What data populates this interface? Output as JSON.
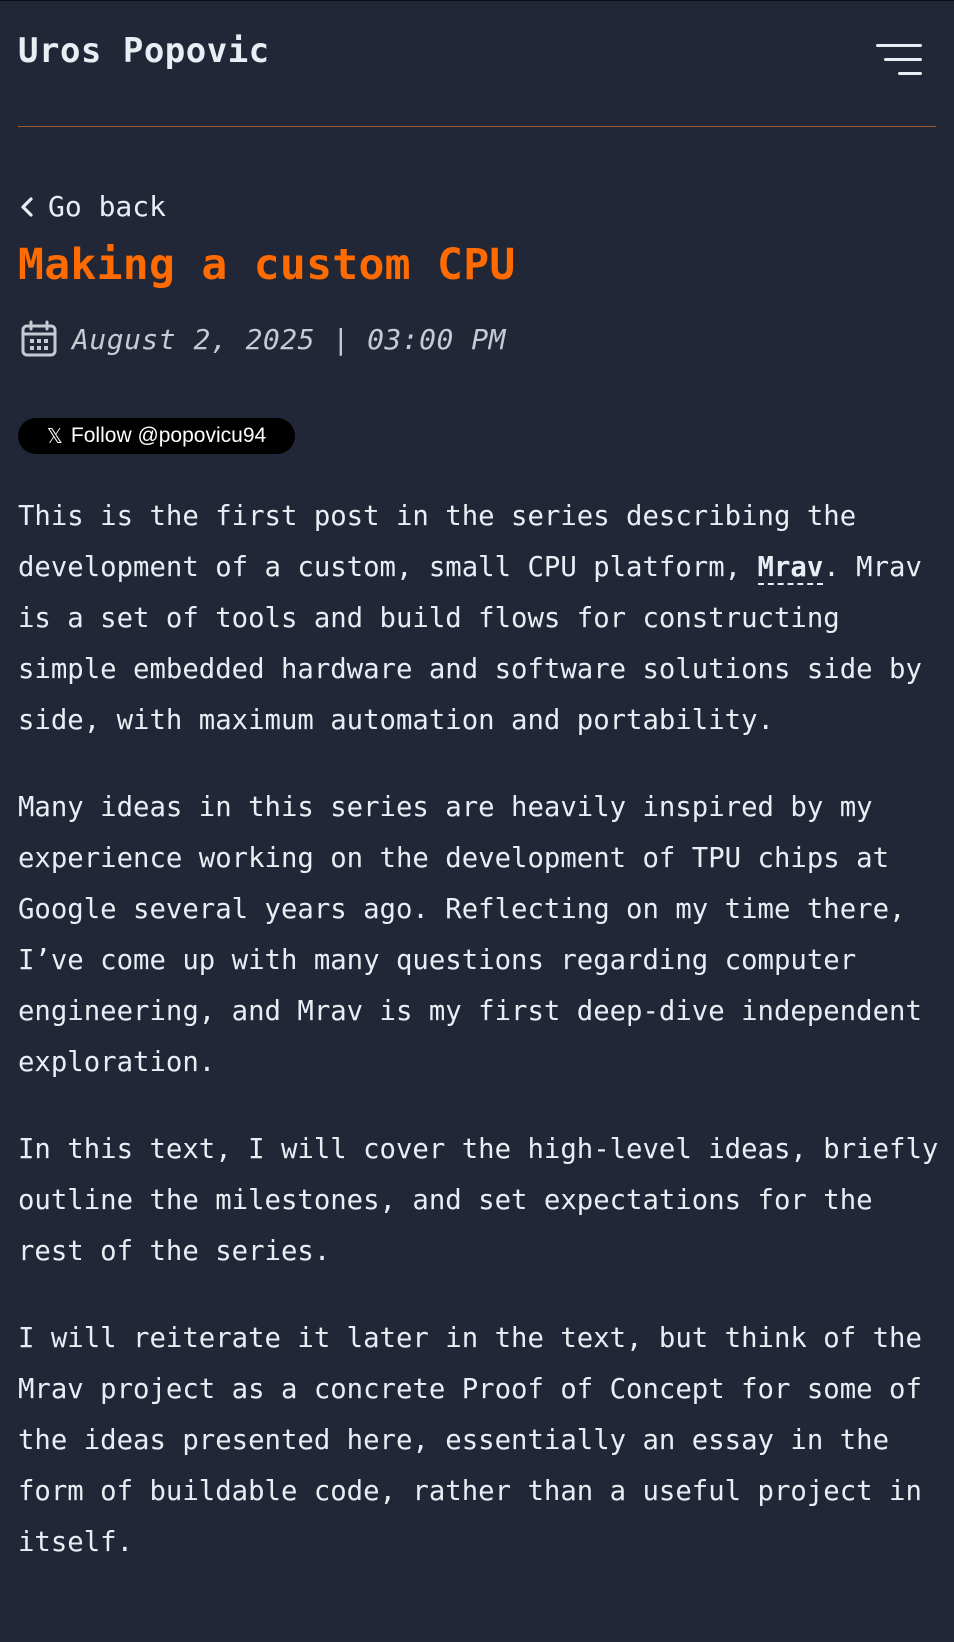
{
  "header": {
    "site_title": "Uros Popovic",
    "menu_icon": "hamburger-menu-icon"
  },
  "nav": {
    "back_label": "Go back",
    "back_icon": "chevron-left-icon"
  },
  "post": {
    "title": "Making a custom CPU",
    "date": "August 2, 2025 | 03:00 PM",
    "date_icon": "calendar-icon"
  },
  "follow_button": {
    "label": "Follow @popovicu94",
    "icon": "x-logo-icon"
  },
  "body": {
    "p1_start": "This is the first post in the series describing the development of a custom, small CPU platform, ",
    "p1_link": "Mrav",
    "p1_end": ". Mrav is a set of tools and build flows for constructing simple embedded hardware and software solutions side by side, with maximum automation and portability.",
    "p2": "Many ideas in this series are heavily inspired by my experience working on the development of TPU chips at Google several years ago. Reflecting on my time there, I’ve come up with many questions regarding computer engineering, and Mrav is my first deep-dive independent exploration.",
    "p3": "In this text, I will cover the high-level ideas, briefly outline the milestones, and set expectations for the rest of the series.",
    "p4": "I will reiterate it later in the text, but think of the Mrav project as a concrete Proof of Concept for some of the ideas presented here, essentially an essay in the form of buildable code, rather than a useful project in itself."
  },
  "colors": {
    "background": "#212737",
    "text": "#eaedf3",
    "accent": "#ff6b01",
    "divider": "#a15a2e"
  }
}
